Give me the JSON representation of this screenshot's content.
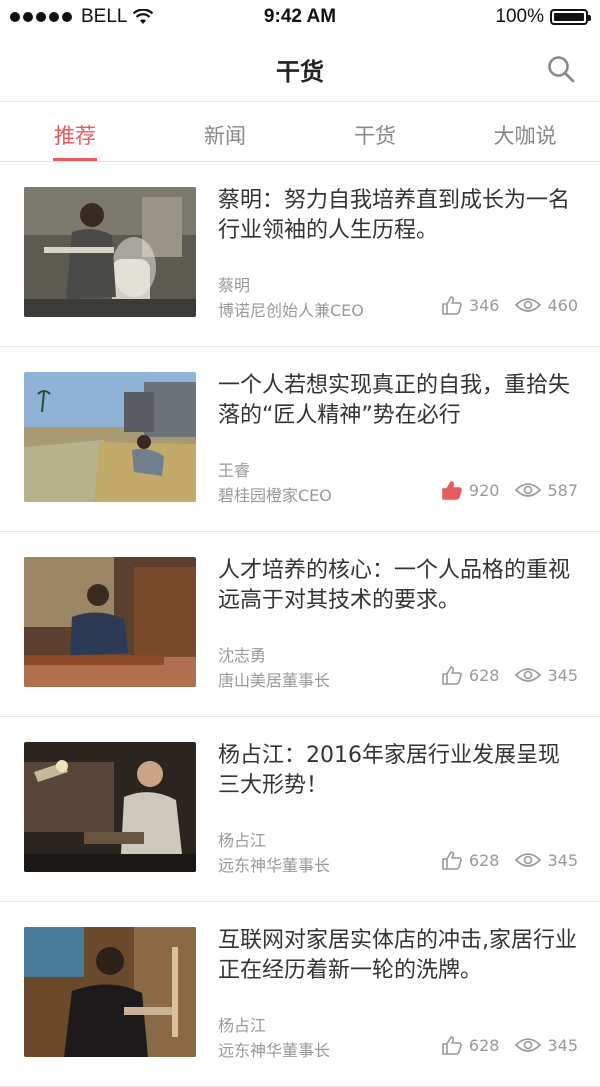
{
  "status": {
    "carrier": "BELL",
    "time": "9:42 AM",
    "battery": "100%"
  },
  "nav": {
    "title": "干货"
  },
  "tabs": [
    {
      "label": "推荐"
    },
    {
      "label": "新闻"
    },
    {
      "label": "干货"
    },
    {
      "label": "大咖说"
    }
  ],
  "colors": {
    "accent": "#e85a5f",
    "muted": "#999999",
    "divider": "#e6e6e6"
  },
  "icons": [
    "search-icon",
    "thumbs-up-icon",
    "eye-icon",
    "wifi-icon",
    "battery-icon"
  ],
  "articles": [
    {
      "title": "蔡明：努力自我培养直到成长为一名行业领袖的人生历程。",
      "author": "蔡明",
      "role": "博诺尼创始人兼CEO",
      "likes": "346",
      "views": "460",
      "liked": false
    },
    {
      "title": "一个人若想实现真正的自我，重拾失落的“匠人精神”势在必行",
      "author": "王睿",
      "role": "碧桂园橙家CEO",
      "likes": "920",
      "views": "587",
      "liked": true
    },
    {
      "title": "人才培养的核心：一个人品格的重视远高于对其技术的要求。",
      "author": "沈志勇",
      "role": "唐山美居董事长",
      "likes": "628",
      "views": "345",
      "liked": false
    },
    {
      "title": "杨占江：2016年家居行业发展呈现三大形势！",
      "author": "杨占江",
      "role": "远东神华董事长",
      "likes": "628",
      "views": "345",
      "liked": false
    },
    {
      "title": "互联网对家居实体店的冲击,家居行业正在经历着新一轮的洗牌。",
      "author": "杨占江",
      "role": "远东神华董事长",
      "likes": "628",
      "views": "345",
      "liked": false
    }
  ]
}
